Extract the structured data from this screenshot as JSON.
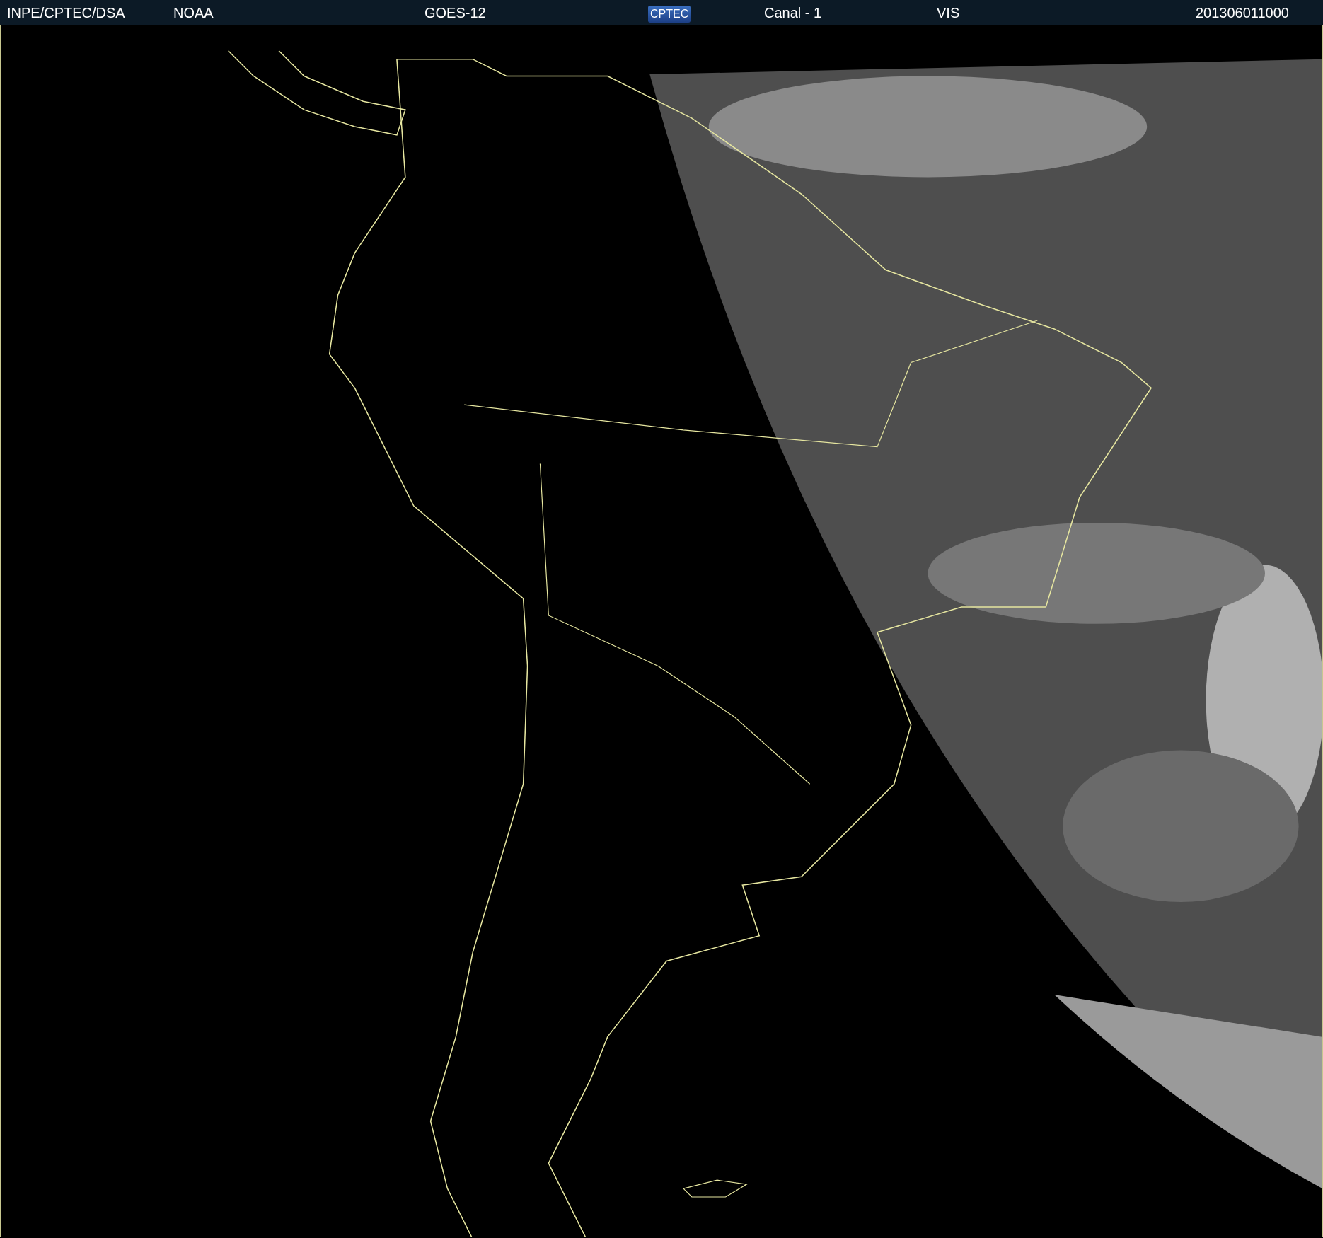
{
  "header": {
    "items": [
      {
        "kind": "text",
        "text": "INPE/CPTEC/DSA"
      },
      {
        "kind": "text",
        "text": "NOAA"
      },
      {
        "kind": "text",
        "text": "GOES-12"
      },
      {
        "kind": "logo",
        "text": "CPTEC"
      },
      {
        "kind": "text",
        "text": "Canal - 1"
      },
      {
        "kind": "text",
        "text": "VIS"
      },
      {
        "kind": "text",
        "text": "201306011000"
      }
    ]
  }
}
